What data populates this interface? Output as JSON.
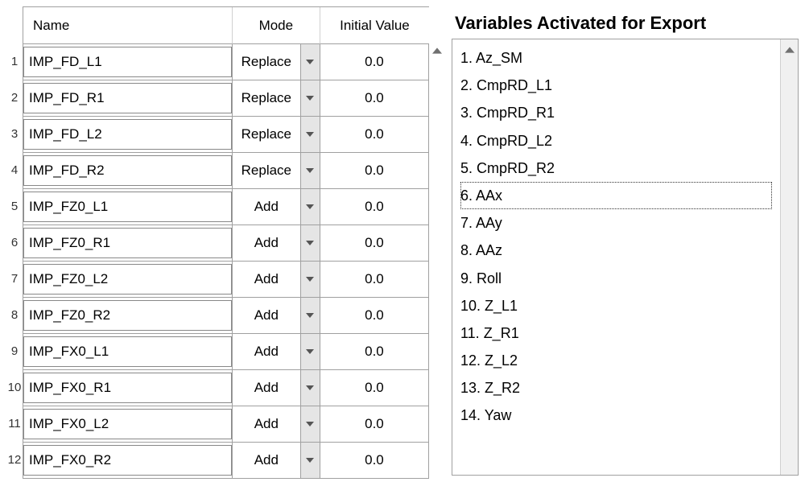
{
  "left": {
    "headers": {
      "name": "Name",
      "mode": "Mode",
      "ival": "Initial Value"
    },
    "rows": [
      {
        "n": 1,
        "name": "IMP_FD_L1",
        "mode": "Replace",
        "ival": "0.0"
      },
      {
        "n": 2,
        "name": "IMP_FD_R1",
        "mode": "Replace",
        "ival": "0.0"
      },
      {
        "n": 3,
        "name": "IMP_FD_L2",
        "mode": "Replace",
        "ival": "0.0"
      },
      {
        "n": 4,
        "name": "IMP_FD_R2",
        "mode": "Replace",
        "ival": "0.0"
      },
      {
        "n": 5,
        "name": "IMP_FZ0_L1",
        "mode": "Add",
        "ival": "0.0"
      },
      {
        "n": 6,
        "name": "IMP_FZ0_R1",
        "mode": "Add",
        "ival": "0.0"
      },
      {
        "n": 7,
        "name": "IMP_FZ0_L2",
        "mode": "Add",
        "ival": "0.0"
      },
      {
        "n": 8,
        "name": "IMP_FZ0_R2",
        "mode": "Add",
        "ival": "0.0"
      },
      {
        "n": 9,
        "name": "IMP_FX0_L1",
        "mode": "Add",
        "ival": "0.0"
      },
      {
        "n": 10,
        "name": "IMP_FX0_R1",
        "mode": "Add",
        "ival": "0.0"
      },
      {
        "n": 11,
        "name": "IMP_FX0_L2",
        "mode": "Add",
        "ival": "0.0"
      },
      {
        "n": 12,
        "name": "IMP_FX0_R2",
        "mode": "Add",
        "ival": "0.0"
      }
    ]
  },
  "right": {
    "title": "Variables Activated for Export",
    "focused_index": 5,
    "items": [
      {
        "n": 1,
        "label": "Az_SM"
      },
      {
        "n": 2,
        "label": "CmpRD_L1"
      },
      {
        "n": 3,
        "label": "CmpRD_R1"
      },
      {
        "n": 4,
        "label": "CmpRD_L2"
      },
      {
        "n": 5,
        "label": "CmpRD_R2"
      },
      {
        "n": 6,
        "label": "AAx"
      },
      {
        "n": 7,
        "label": "AAy"
      },
      {
        "n": 8,
        "label": "AAz"
      },
      {
        "n": 9,
        "label": "Roll"
      },
      {
        "n": 10,
        "label": "Z_L1"
      },
      {
        "n": 11,
        "label": "Z_R1"
      },
      {
        "n": 12,
        "label": "Z_L2"
      },
      {
        "n": 13,
        "label": "Z_R2"
      },
      {
        "n": 14,
        "label": "Yaw"
      }
    ]
  }
}
